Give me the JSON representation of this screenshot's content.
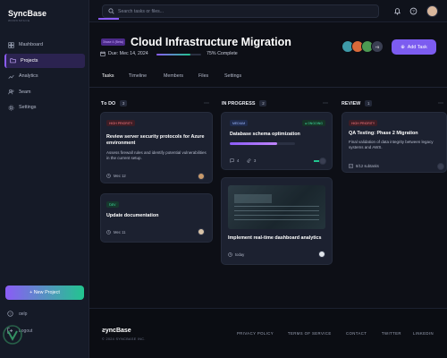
{
  "app": {
    "name": "SyncBase",
    "subtitle": "WORKSPACE"
  },
  "sidebar": {
    "items": [
      {
        "label": "Mashboard",
        "icon": "grid-icon",
        "active": false
      },
      {
        "label": "Projects",
        "icon": "folder-icon",
        "active": true
      },
      {
        "label": "Analytics",
        "icon": "chart-icon",
        "active": false
      },
      {
        "label": "Ƽeam",
        "icon": "users-icon",
        "active": false
      },
      {
        "label": "Settings",
        "icon": "gear-icon",
        "active": false
      }
    ],
    "new_project": "+ New Project",
    "help": "ɑelp",
    "logout": "Logout"
  },
  "topbar": {
    "search_placeholder": "Search tasks or files..."
  },
  "project": {
    "badge": "Ƽhase 4 (Beta)",
    "title": "Cloud Infrastructure Migration",
    "date": "Due: Mec 14, 2024",
    "progress": 0.75,
    "progress_text": "75% Complete",
    "extra_members": "+5",
    "add_task": "Add Task"
  },
  "tabs": [
    "Tasks",
    "Ƭimeline",
    "Members",
    "Files",
    "Settings"
  ],
  "columns": [
    {
      "title": "Ƭo DO",
      "count": "3",
      "cards": [
        {
          "tag": "HIGH PRIORITY",
          "tag_color": "#e0525c",
          "title": "Review server security protocols for Azure environment",
          "desc": "Assess firewall rules and identify potential vulnerabilities in the current setup.",
          "date": "Mec 12"
        },
        {
          "tag": "ƊEV",
          "tag_color": "#22c58f",
          "title": "Update documentation",
          "date": "Mec 11"
        }
      ]
    },
    {
      "title": "IN PROGRESS",
      "count": "2",
      "cards": [
        {
          "tag": "MEDIUM",
          "tag_color": "#7aa2ff",
          "status": "● ONGOING",
          "status_color": "#22c58f",
          "title": "Database schema optimization",
          "progress": 0.72,
          "comments": "4",
          "attachments": "3"
        },
        {
          "title": "Implement real-time dashboard analytics",
          "date": "today"
        }
      ]
    },
    {
      "title": "REVIEW",
      "count": "1",
      "cards": [
        {
          "tag": "HIGH PRIORITY",
          "tag_color": "#e0525c",
          "title": "QA Testing: Phase 2 Migration",
          "desc": "Final validation of data integrity between legacy systems and AWS.",
          "subtasks": "8/12 subtasks"
        }
      ]
    }
  ],
  "footer": {
    "brand": "ƨyncBase",
    "copyright": "© 2024 SYNCBASE INC.",
    "links": [
      "PRIVACY POLICY",
      "ƬERMS OF SERVICE",
      "CONTACT",
      "ƬWITTER",
      "LINKEDIN"
    ]
  },
  "colors": {
    "accent": "#8b5cf6",
    "success": "#22c58f",
    "danger": "#e0525c",
    "background": "#0d0f16",
    "sidebar": "#151a27"
  }
}
